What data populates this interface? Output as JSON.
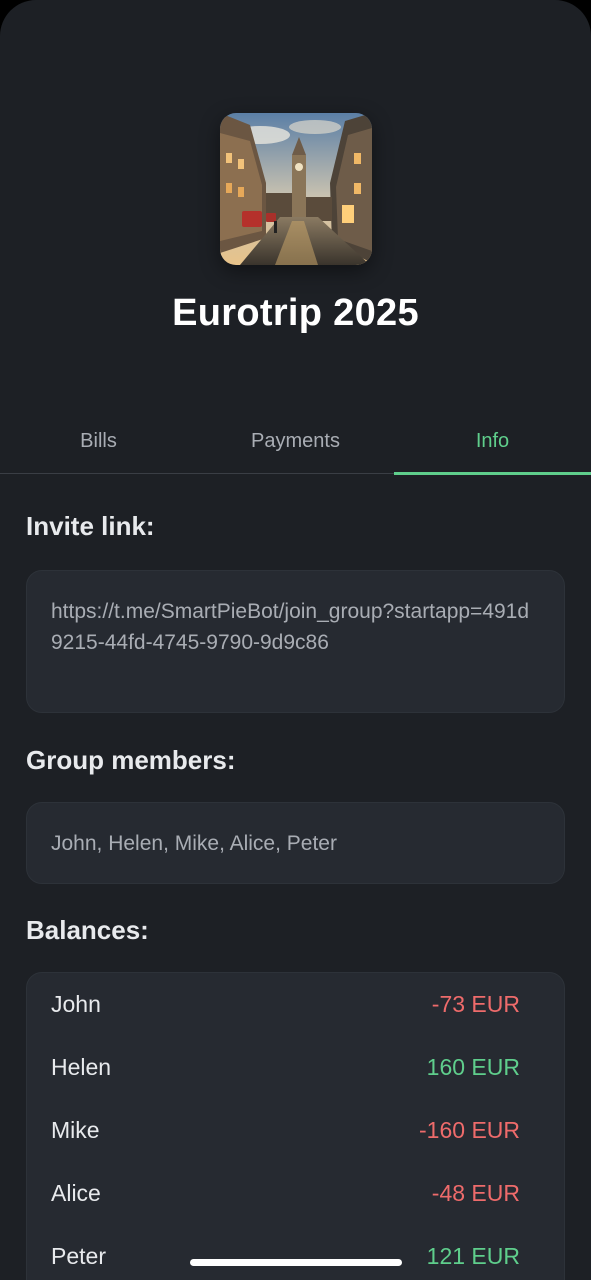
{
  "group": {
    "title": "Eurotrip 2025",
    "cover_icon": "london-street-photo"
  },
  "tabs": [
    {
      "label": "Bills",
      "active": false
    },
    {
      "label": "Payments",
      "active": false
    },
    {
      "label": "Info",
      "active": true
    }
  ],
  "invite": {
    "heading": "Invite link:",
    "url": "https://t.me/SmartPieBot/join_group?startapp=491d9215-44fd-4745-9790-9d9c86"
  },
  "members": {
    "heading": "Group members:",
    "list": "John, Helen, Mike, Alice, Peter"
  },
  "balances": {
    "heading": "Balances:",
    "rows": [
      {
        "name": "John",
        "amount": "-73 EUR"
      },
      {
        "name": "Helen",
        "amount": "160 EUR"
      },
      {
        "name": "Mike",
        "amount": "-160 EUR"
      },
      {
        "name": "Alice",
        "amount": "-48 EUR"
      },
      {
        "name": "Peter",
        "amount": "121 EUR"
      }
    ]
  },
  "colors": {
    "background": "#1d2025",
    "card": "#262a31",
    "accent": "#5fce8c",
    "negative": "#ee6b6b"
  }
}
